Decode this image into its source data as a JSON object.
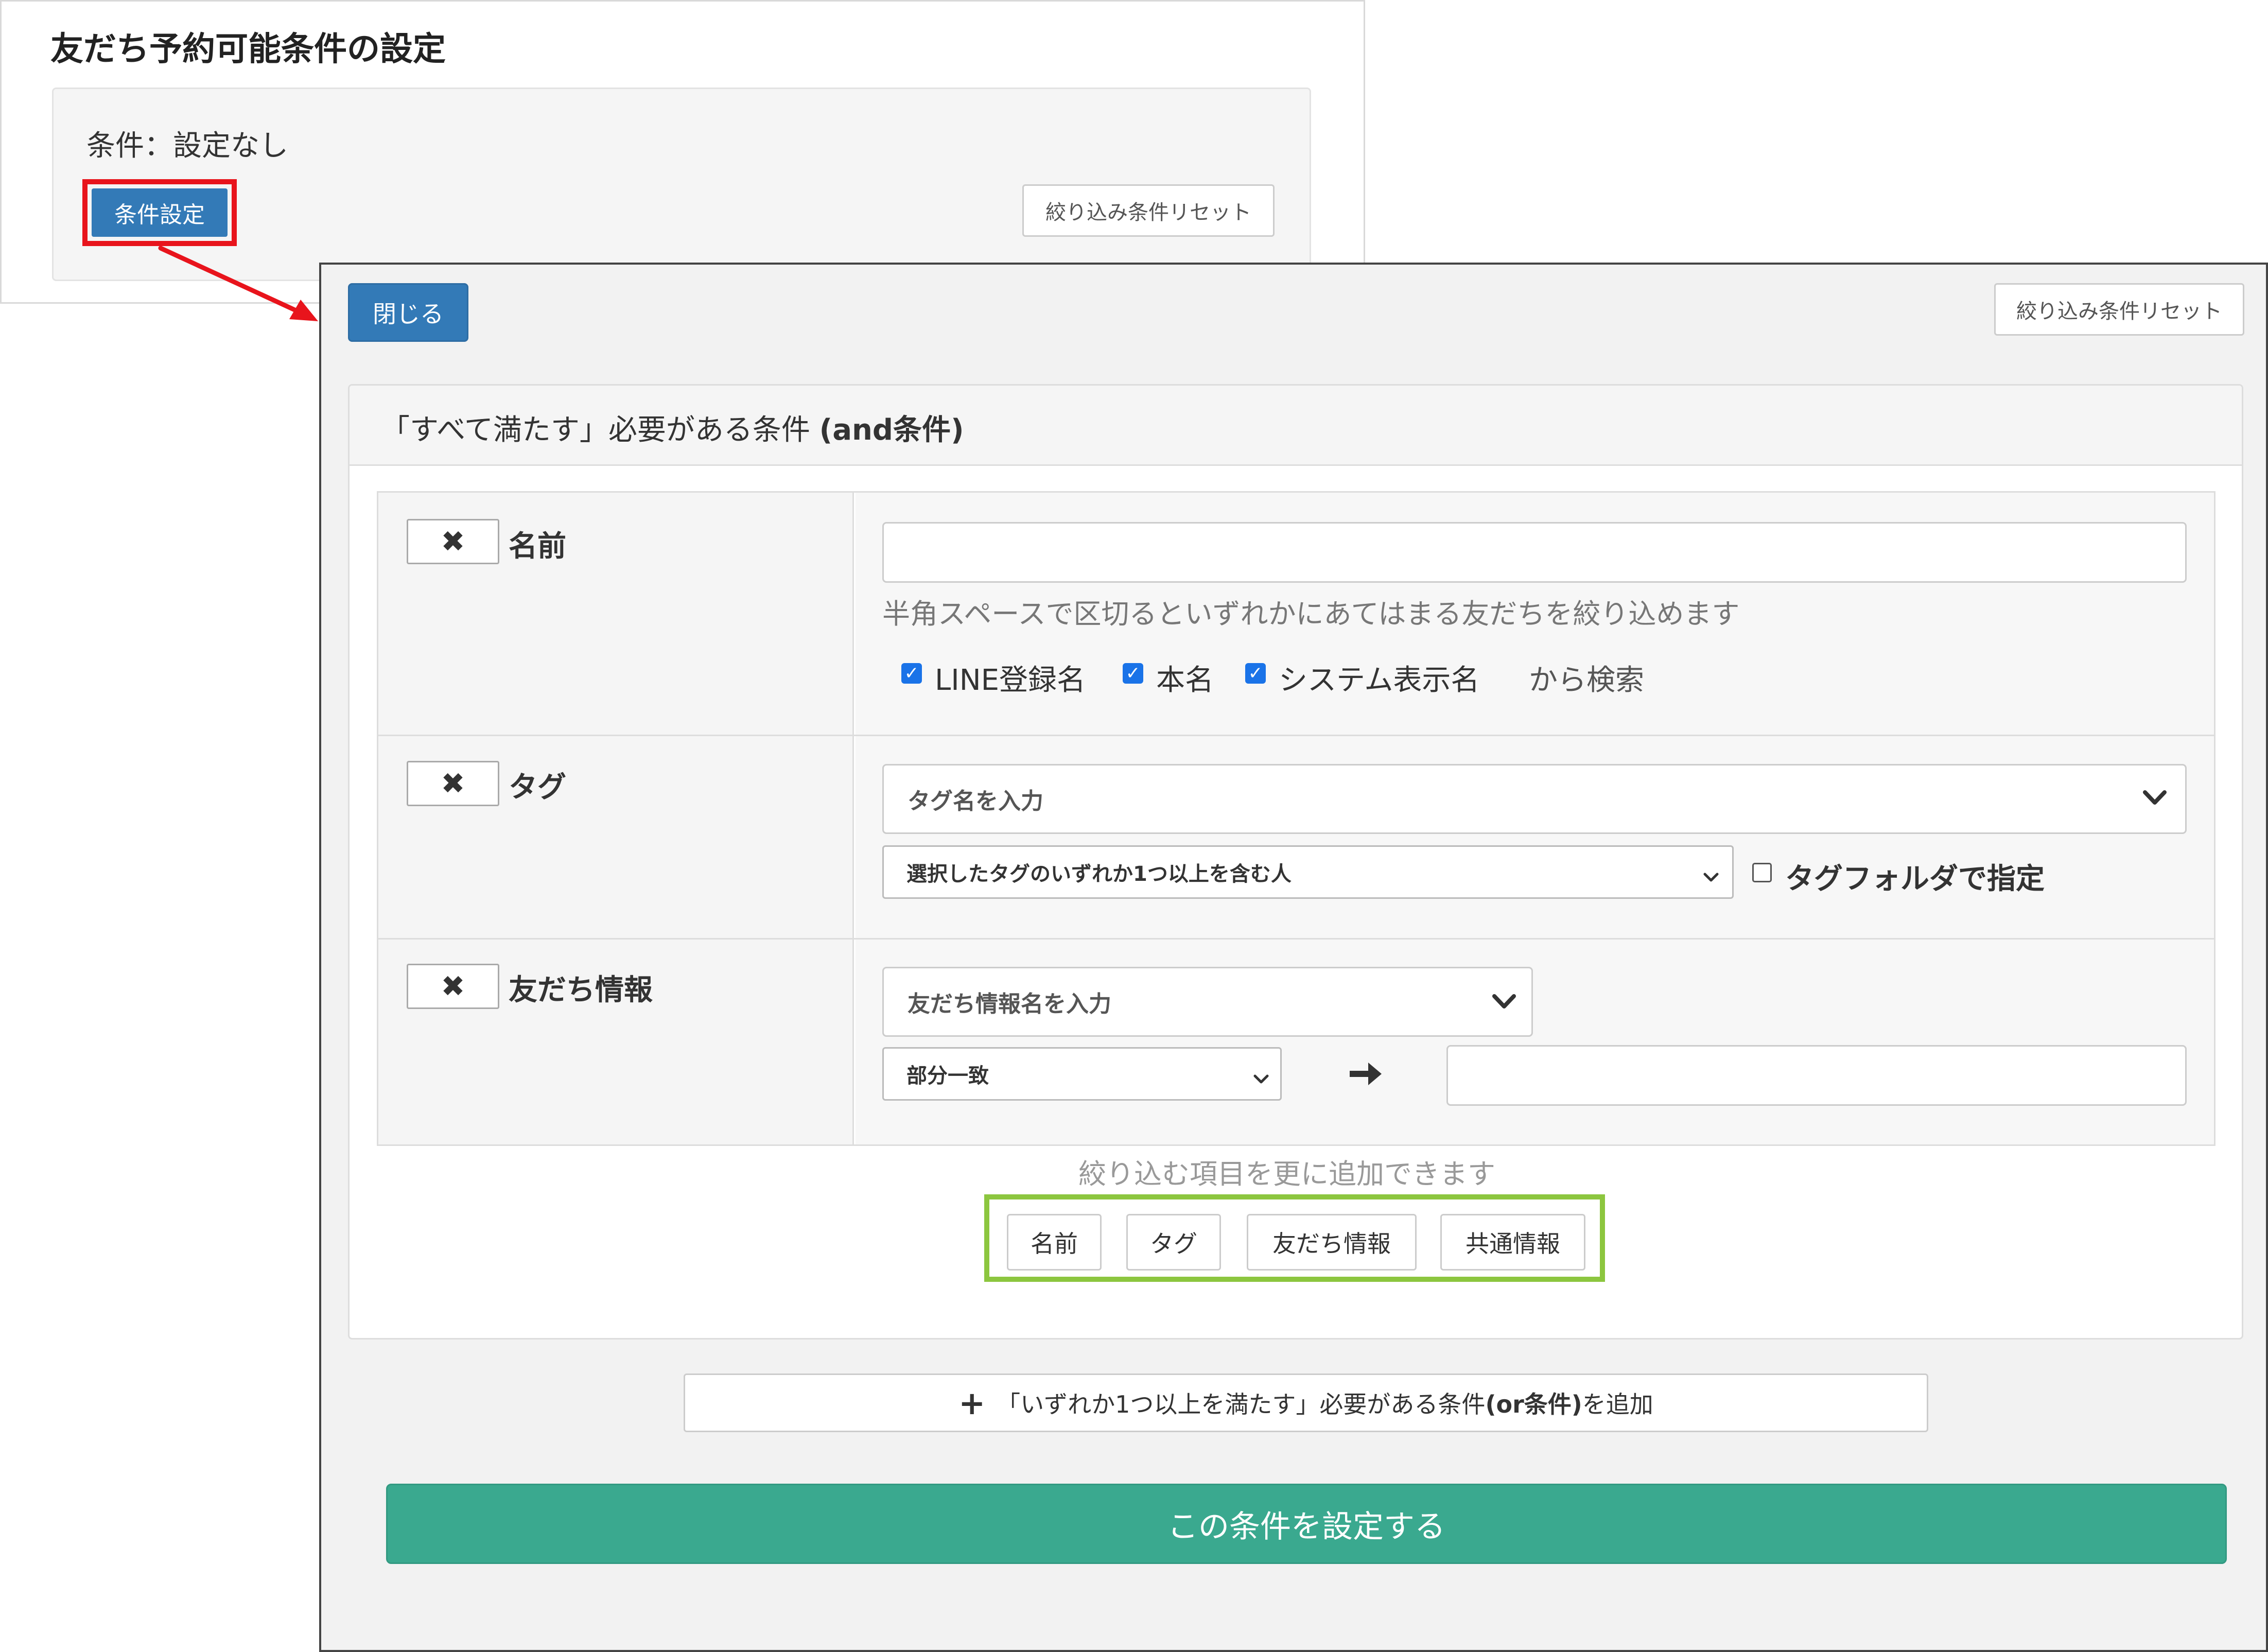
{
  "background": {
    "title": "友だち予約可能条件の設定",
    "condition_text": "条件：設定なし",
    "condition_button": "条件設定",
    "reset_button": "絞り込み条件リセット"
  },
  "modal": {
    "close_button": "閉じる",
    "reset_button": "絞り込み条件リセット",
    "and_panel": {
      "title_prefix": "「すべて満たす」必要がある条件 ",
      "title_bold": "(and条件)"
    },
    "rows": {
      "name": {
        "remove_icon": "✖",
        "label": "名前",
        "input_value": "",
        "hint": "半角スペースで区切るといずれかにあてはまる友だちを絞り込めます",
        "checkboxes": [
          {
            "label": "LINE登録名",
            "checked": true
          },
          {
            "label": "本名",
            "checked": true
          },
          {
            "label": "システム表示名",
            "checked": true
          }
        ],
        "search_suffix": "から検索"
      },
      "tag": {
        "remove_icon": "✖",
        "label": "タグ",
        "tag_select": "タグ名を入力",
        "match_select": "選択したタグのいずれか1つ以上を含む人",
        "folder_checkbox": {
          "label": "タグフォルダで指定",
          "checked": false
        }
      },
      "friend_info": {
        "remove_icon": "✖",
        "label": "友だち情報",
        "info_select": "友だち情報名を入力",
        "match_select": "部分一致",
        "arrow_icon": "➜",
        "value_input": ""
      }
    },
    "add_hint": "絞り込む項目を更に追加できます",
    "add_buttons": [
      "名前",
      "タグ",
      "友だち情報",
      "共通情報"
    ],
    "or_button": {
      "prefix": "「いずれか1つ以上を満たす」必要がある条件",
      "bold": "(or条件)",
      "suffix": "を追加"
    },
    "submit_button": "この条件を設定する"
  },
  "colors": {
    "primary_blue": "#337ab7",
    "submit_green": "#3aa98f",
    "highlight_red": "#e8141c",
    "highlight_green": "#8cc63f",
    "checkbox_blue": "#1a73e8"
  }
}
